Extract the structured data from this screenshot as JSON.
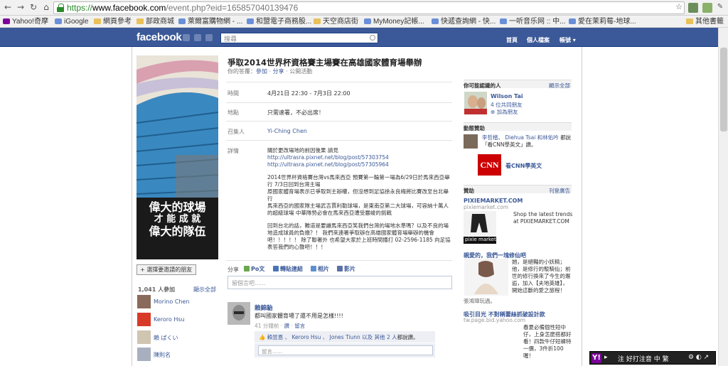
{
  "browser": {
    "url_scheme": "https://",
    "url_host": "www.facebook.com",
    "url_path": "/event.php?eid=165857040139476",
    "bookmarks": [
      "Yahoo!奇摩",
      "iGoogle",
      "網頁參考",
      "部政商城",
      "萊爾富購物網 - ...",
      "和盟電子商務股...",
      "天空商店街",
      "MyMoney記帳...",
      "快遞查詢網 - 快...",
      "一听音乐网 :: 中...",
      "愛在茉莉莓-地球...",
      "其他書籤"
    ]
  },
  "facebook": {
    "logo": "facebook",
    "search_placeholder": "搜尋",
    "nav": {
      "home": "首頁",
      "profile": "個人檔案",
      "account": "帳號 ▾"
    }
  },
  "event": {
    "title": "爭取2014世界杯資格賽主場賽在高雄國家體育場舉辦",
    "rsvp_label": "你的答覆：",
    "rsvp_join": "參加",
    "rsvp_share": "分享",
    "rsvp_public": "公開活動",
    "time_label": "時間",
    "time_value": "4月21日 22:30 - 7月3日 22:00",
    "location_label": "地點",
    "location_value": "只需速署，不必出席！",
    "organizer_label": "召集人",
    "organizer_value": "Yi-Ching Chen",
    "details_label": "詳情",
    "details_intro": "關於更改場地的前因後果 請見",
    "details_link1": "http://ultrasra.pixnet.net/blog/post/57303754",
    "details_link2": "http://ultrasra.pixnet.net/blog/post/57305964",
    "details_p2": "2014世界杯資格賽台灣vs馬來西亞 預賽第一輪第一場為6/29日於馬來西亞舉行 7/3日回到台灣主場",
    "details_p3": "原國家體育場表示已爭取到主辦權，但沒想到足協徐永良梅將比賽改至台北舉行",
    "details_p4": "馬來西亞的國家隊主場武吉賈利勒球場，是東南亞第二大球場，可容納十萬人的超級球場 中華隊勢必會在馬來西亞遭受嚴峻的挑戰",
    "details_p5": "回到台北的話，難道是要讓馬來西亞笑我們台灣的場地水準嗎？以及不良的場地造成球員的負擔？！ 我們來連署爭取辦在高雄國家體育場舉辦的機會吧！！！！！ 除了聯署外 也希望大家於上班時間播打 02-2596-1185 向足協表答我們的心聲吧！！！",
    "photo_line1": "偉大的球場",
    "photo_line2": "才 能 成 就",
    "photo_line3": "偉大的隊伍"
  },
  "left": {
    "invite_button": "+ 選擇要邀請的朋友",
    "attending": "1,041 人參加",
    "show_all": "顯示全部",
    "attendees": [
      "Morino Chen",
      "Keroro Hsu",
      "賴 ぱくい",
      "陳則名"
    ]
  },
  "share": {
    "label": "分享",
    "post": "Po文",
    "link": "轉貼連結",
    "photo": "相片",
    "video": "影片",
    "placeholder": "留個言吧......"
  },
  "post": {
    "author": "賴錦駘",
    "text": "都叫國家體育場了還不用是怎樣!!!!",
    "time": "41 分鐘前 · ",
    "like": "讚",
    "comment": "留言",
    "likers": "賴昱恩 、 Keroro Hsu 、 Jones Tiunn 以及",
    "others": "其他 2 人",
    "says": "都說讚。",
    "comment_placeholder": "留言......"
  },
  "sidebar": {
    "pymk_header": "你可能認識的人",
    "pymk_show_all": "顯示全部",
    "pymk_name": "Wilson Tai",
    "pymk_mutual": "4 位共同朋友",
    "pymk_add": "加為朋友",
    "sponsored_header": "動態贊助",
    "sponsored_people": "李哲楷",
    "sponsored_people2": "Diehua Tsai",
    "sponsored_people3": "和林佑吟",
    "sponsored_text": "都說「看CNN學英文」讚。",
    "cnn_label": "看CNN學英文",
    "ads_header": "贊助",
    "ads_create": "刊登廣告",
    "ad1_title": "PIXIEMARKET.COM",
    "ad1_url": "pixiemarket.com",
    "ad1_text": "Shop the latest trends at PIXIEMARKET.COM",
    "ad1_img_label": "pixie market",
    "ad2_title": "親愛的，我們一塊修仙吧",
    "ad2_text": "她，是絕豔的小妖精；他，是修行的駁騎仙；前世的修行換來了今生的邂逅，加入【夫地英雄】，開始這斷的愛之旅程！",
    "ad2_more": "張鴻瑋玩過。",
    "ad3_title": "吸引目光 不對稱蕾絲抓破設計款",
    "ad3_url": "tw.page.bid.yahoo.com",
    "ad3_text": "春夏必備個性短中仔，上身怎麼搭都好看！四款牛仔短褲特一價，3件折100喔！"
  },
  "ime": {
    "text": "注 好打注音   中  繁"
  }
}
